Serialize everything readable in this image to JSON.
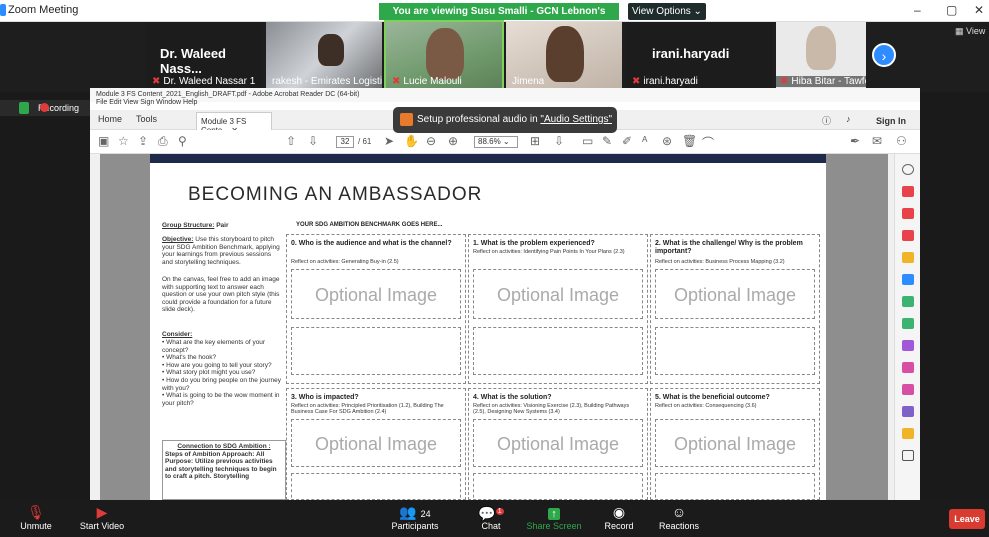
{
  "zoom": {
    "window_title": "Zoom Meeting",
    "viewing_banner": "You are viewing Susu Smalli - GCN Lebnon's screen",
    "view_options": "View Options",
    "view_side": "View",
    "window_controls": [
      "–",
      "▢",
      "✕"
    ]
  },
  "participants_strip": [
    {
      "display": "Dr. Waleed Nass...",
      "label": "Dr. Waleed Nassar 1"
    },
    {
      "label": "rakesh - Emirates Logisti..."
    },
    {
      "label": "Lucie Malouli"
    },
    {
      "label": "Jimena"
    },
    {
      "display": "irani.haryadi",
      "label": "irani.haryadi"
    },
    {
      "label": "Hiba Bitar - Tawfeer l..."
    }
  ],
  "recording": {
    "label": "Recording"
  },
  "acrobat": {
    "title": "Module 3 FS Content_2021_English_DRAFT.pdf - Adobe Acrobat Reader DC (64-bit)",
    "menu": "File  Edit  View  Sign  Window  Help",
    "tabs": {
      "home": "Home",
      "tools": "Tools",
      "doc": "Module 3 FS Conte..."
    },
    "sign_in": "Sign In",
    "page_current": "32",
    "page_total": "/ 61",
    "zoom": "88.6%"
  },
  "audio_popup": {
    "text": "Setup professional audio in ",
    "link": "\"Audio Settings\""
  },
  "document": {
    "title": "BECOMING AN AMBASSADOR",
    "group_label": "Group Structure:",
    "group_value": "Pair",
    "benchmark_head": "YOUR SDG AMBITION BENCHMARK GOES HERE...",
    "objective_label": "Objective:",
    "objective_text": "Use this storyboard to pitch your SDG Ambition Benchmark, applying your learnings from previous sessions and storytelling techniques.",
    "canvas_text": "On the canvas, feel free to add an image with supporting text to answer each question or use your own pitch style (this could provide a foundation for a future slide deck).",
    "consider_label": "Consider:",
    "consider_items": [
      "What are the key elements of your concept?",
      "What's the hook?",
      "How are you going to tell your story?",
      "What story plot might you use?",
      "How do you bring people on the journey with you?",
      "What is going to be the wow moment in your pitch?"
    ],
    "connection_label": "Connection to SDG Ambition :",
    "steps_text": "Steps of Ambition Approach: All",
    "purpose_text": "Purpose: Utilize previous activities and storytelling techniques to begin to craft a pitch. Storytelling",
    "optional_image": "Optional Image",
    "cards": [
      {
        "q": "0. Who is the audience and what is the channel?",
        "r": "Reflect on activities: Generating Buy-in (2.5)"
      },
      {
        "q": "1. What is the problem experienced?",
        "r": "Reflect on activities: Identifying Pain Points In Your Plans (2.3)"
      },
      {
        "q": "2. What is the challenge/ Why is the problem important?",
        "r": "Reflect on activities: Business Process Mapping (3.2)"
      },
      {
        "q": "3. Who is impacted?",
        "r": "Reflect on activities: Principled Prioritisation (1.2), Building The Business Case For SDG Ambition (2.4)"
      },
      {
        "q": "4. What is the solution?",
        "r": "Reflect on activities: Visioning Exercise (2.3), Building Pathways (2.5), Designing New Systems (3.4)"
      },
      {
        "q": "5. What is the beneficial outcome?",
        "r": "Reflect on activities: Consequencing (3.6)"
      }
    ]
  },
  "bottom_bar": {
    "unmute": "Unmute",
    "start_video": "Start Video",
    "participants": "Participants",
    "participants_count": "24",
    "chat": "Chat",
    "chat_badge": "1",
    "share_screen": "Share Screen",
    "record": "Record",
    "reactions": "Reactions",
    "leave": "Leave"
  },
  "colors": {
    "share_green": "#2ea84a",
    "leave_red": "#d93b30",
    "zoom_blue": "#2d8cff",
    "page_header": "#1f2a4a"
  }
}
